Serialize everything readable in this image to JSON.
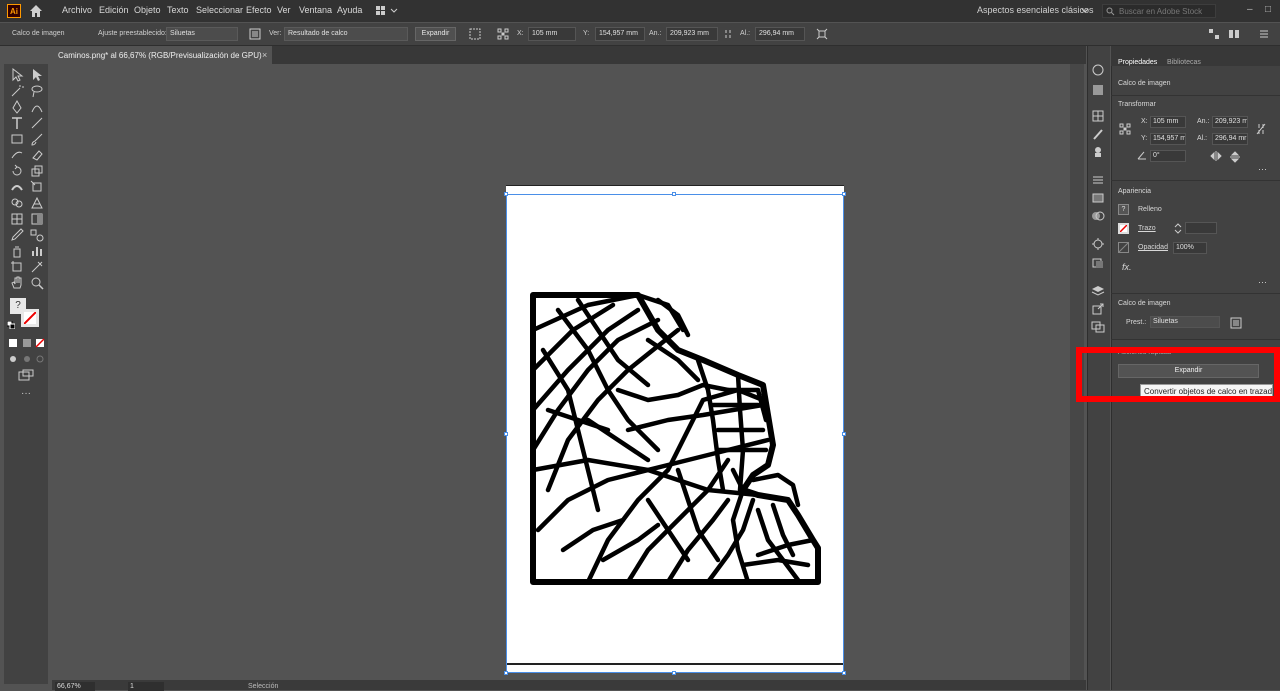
{
  "app": {
    "logo": "Ai",
    "workspace": "Aspectos esenciales clásicos",
    "stock_search_placeholder": "Buscar en Adobe Stock"
  },
  "menu": [
    "Archivo",
    "Edición",
    "Objeto",
    "Texto",
    "Seleccionar",
    "Efecto",
    "Ver",
    "Ventana",
    "Ayuda"
  ],
  "control_bar": {
    "object_label": "Calco de imagen",
    "preset_label": "Ajuste preestablecido:",
    "preset_value": "Siluetas",
    "view_label": "Ver:",
    "view_value": "Resultado de calco",
    "expand_label": "Expandir",
    "x_label": "X:",
    "x_value": "105 mm",
    "y_label": "Y:",
    "y_value": "154,957 mm",
    "w_label": "An.:",
    "w_value": "209,923 mm",
    "h_label": "Al.:",
    "h_value": "296,94 mm"
  },
  "document_tab": {
    "title": "Caminos.png* al 66,67% (RGB/Previsualización de GPU)",
    "close": "×"
  },
  "toolbar": {
    "fill_unknown": "?"
  },
  "status_bar": {
    "zoom": "66,67%",
    "page": "1",
    "tool": "Selección"
  },
  "panel": {
    "tabs": [
      "Propiedades",
      "Bibliotecas"
    ],
    "object_type": "Calco de imagen",
    "transform": {
      "title": "Transformar",
      "x_label": "X:",
      "x_value": "105 mm",
      "y_label": "Y:",
      "y_value": "154,957 mm",
      "w_label": "An.:",
      "w_value": "209,923 mr",
      "h_label": "Al.:",
      "h_value": "296,94 mr",
      "angle_value": "0°"
    },
    "appearance": {
      "title": "Apariencia",
      "fill_label": "Relleno",
      "stroke_label": "Trazo",
      "opacity_label": "Opacidad",
      "opacity_value": "100%",
      "fx_label": "fx."
    },
    "trace": {
      "title": "Calco de imagen",
      "preset_label": "Prest.:",
      "preset_value": "Siluetas"
    },
    "quick_actions": {
      "title": "Acciones rápidas",
      "expand_label": "Expandir",
      "tooltip": "Convertir objetos de calco en trazados"
    }
  },
  "colors": {
    "highlight": "#ff0000",
    "selection": "#4a8fe8",
    "ui_dark": "#323232",
    "canvas": "#535353"
  }
}
